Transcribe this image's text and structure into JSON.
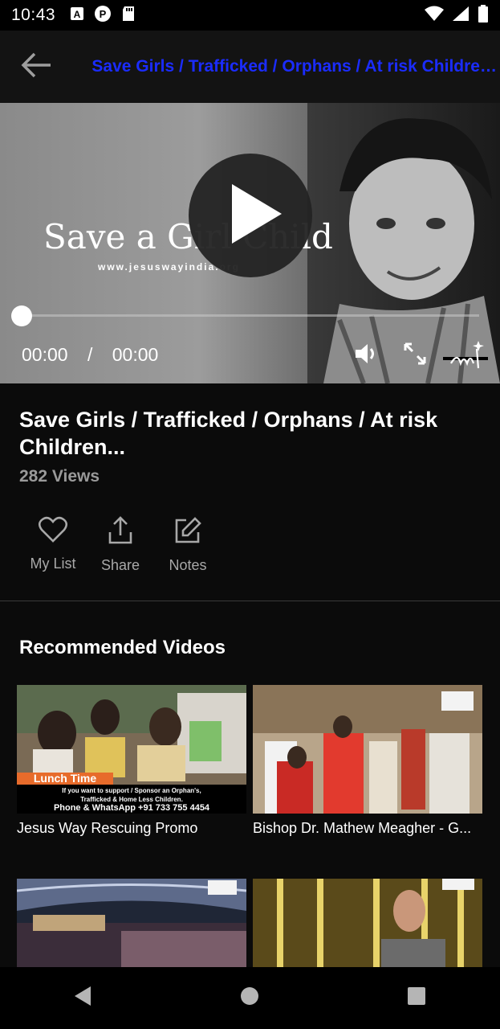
{
  "status_bar": {
    "time": "10:43",
    "notification_icons": [
      "a-icon",
      "p-icon",
      "sd-card-icon"
    ],
    "system_icons": [
      "wifi-icon",
      "signal-icon",
      "battery-icon"
    ]
  },
  "app_bar": {
    "back_icon": "arrow-left-icon",
    "title": "Save Girls / Trafficked / Orphans / At risk Children...",
    "title_color": "#1b2cff"
  },
  "player": {
    "overlay_text": "Save a Girl Child",
    "overlay_url": "www.jesuswayindia.org",
    "current_time": "00:00",
    "separator": "/",
    "duration": "00:00",
    "progress_fraction": 0,
    "controls": [
      "volume-icon",
      "fullscreen-icon"
    ]
  },
  "video": {
    "title": "Save Girls / Trafficked / Orphans / At risk Children...",
    "views": "282 Views"
  },
  "actions": [
    {
      "label": "My List",
      "icon": "heart-icon"
    },
    {
      "label": "Share",
      "icon": "share-icon"
    },
    {
      "label": "Notes",
      "icon": "edit-icon"
    }
  ],
  "recommended": {
    "heading": "Recommended Videos",
    "items": [
      {
        "caption": "Jesus Way Rescuing Promo",
        "banner": "Lunch Time",
        "line1": "If you want to support / Sponsor an Orphan's,",
        "line2": "Trafficked & Home Less Children.",
        "line3": "Phone & WhatsApp +91 733 755 4454"
      },
      {
        "caption": "Bishop Dr. Mathew Meagher - G..."
      },
      {
        "caption": ""
      },
      {
        "caption": ""
      }
    ]
  },
  "nav_bar": {
    "icons": [
      "back-triangle-icon",
      "home-circle-icon",
      "recents-square-icon"
    ]
  }
}
